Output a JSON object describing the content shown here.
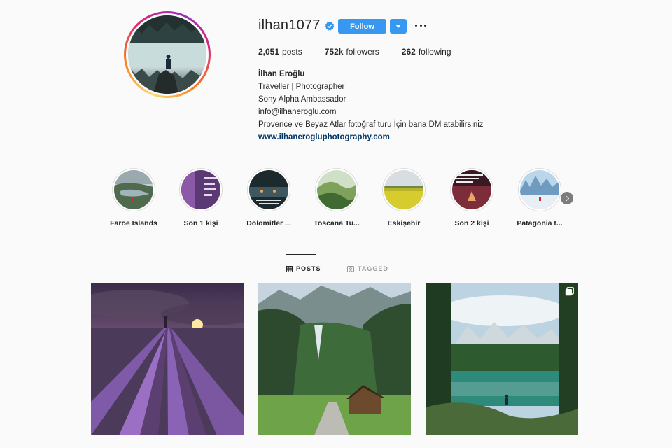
{
  "profile": {
    "username": "ilhan1077",
    "verified": true,
    "follow_label": "Follow",
    "stats": [
      {
        "value": "2,051",
        "label": "posts"
      },
      {
        "value": "752k",
        "label": "followers"
      },
      {
        "value": "262",
        "label": "following"
      }
    ],
    "bio": {
      "name": "İlhan Eroğlu",
      "lines": [
        "Traveller | Photographer",
        "Sony Alpha Ambassador",
        "info@ilhaneroglu.com",
        "Provence ve Beyaz Atlar fotoğraf turu İçin bana DM atabilirsiniz"
      ],
      "link": "www.ilhanerogluphotography.com"
    }
  },
  "highlights": [
    {
      "label": "Faroe Islands"
    },
    {
      "label": "Son 1 kişi"
    },
    {
      "label": "Dolomitler ..."
    },
    {
      "label": "Toscana Tu..."
    },
    {
      "label": "Eskişehir"
    },
    {
      "label": "Son 2 kişi"
    },
    {
      "label": "Patagonia t..."
    }
  ],
  "tabs": [
    {
      "label": "POSTS",
      "active": true,
      "icon": "grid-icon"
    },
    {
      "label": "TAGGED",
      "active": false,
      "icon": "tag-icon"
    }
  ],
  "colors": {
    "accent": "#3897f0",
    "link": "#003569",
    "text": "#262626",
    "muted": "#999999",
    "background": "#fafafa"
  }
}
